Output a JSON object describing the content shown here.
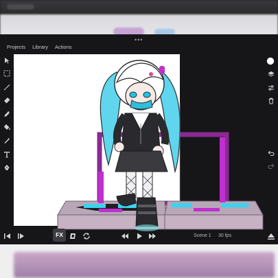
{
  "menu": {
    "projects": "Projects",
    "library": "Library",
    "actions": "Actions"
  },
  "drag_handle": "•••",
  "tools": [
    "select-arrow-icon",
    "marquee-icon",
    "brush-icon",
    "eraser-icon",
    "smudge-icon",
    "fill-bucket-icon",
    "eyedropper-icon",
    "text-icon",
    "pen-icon"
  ],
  "right_tools": [
    "color-swatch-icon",
    "layers-icon",
    "adjustments-icon",
    "trash-icon",
    "undo-icon",
    "redo-icon"
  ],
  "playback": {
    "fx_label": "FX",
    "scene_label": "Scene 1",
    "fps_label": "30 fps"
  },
  "colors": {
    "cyan": "#3ad3ef",
    "magenta": "#c02fcf",
    "dark_panel": "#161618",
    "canvas_bg": "#ffffff"
  }
}
